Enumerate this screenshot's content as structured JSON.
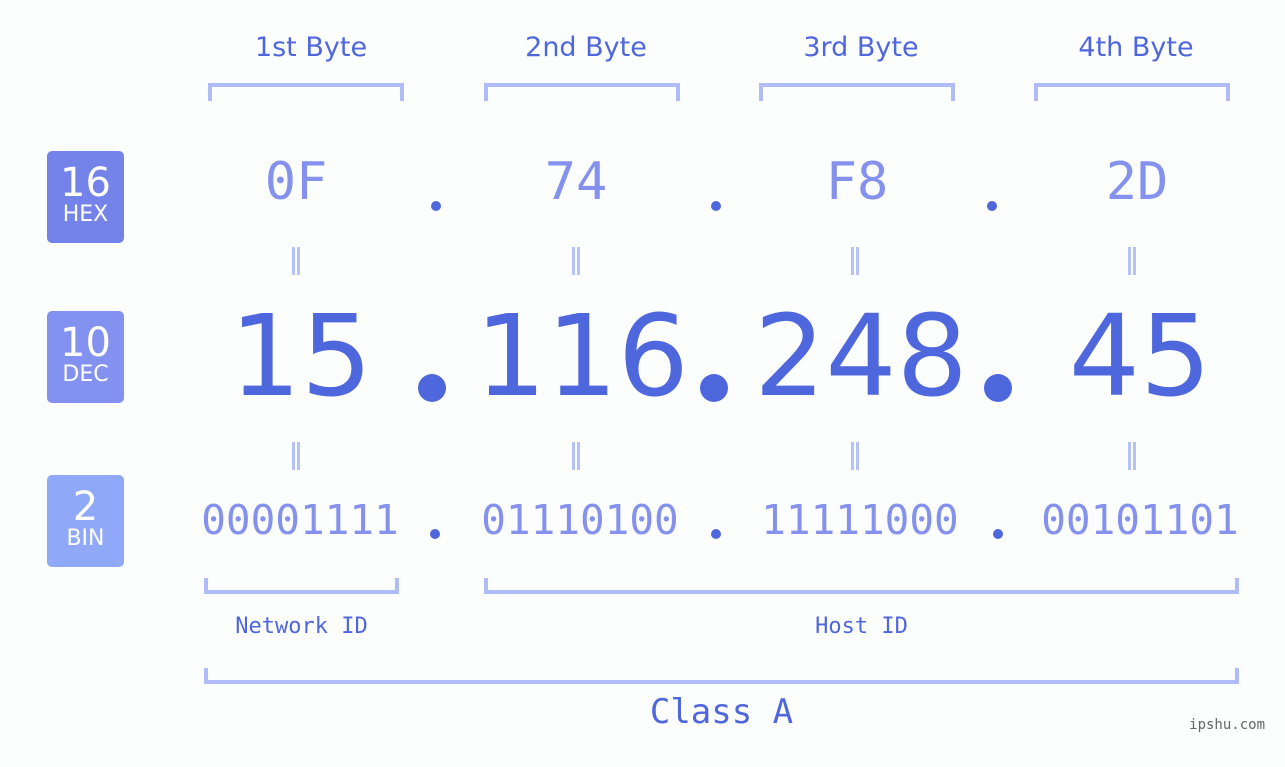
{
  "badges": [
    {
      "base": "16",
      "name": "HEX",
      "color": "#7383ea"
    },
    {
      "base": "10",
      "name": "DEC",
      "color": "#8392f0"
    },
    {
      "base": "2",
      "name": "BIN",
      "color": "#8fa8f8"
    }
  ],
  "byte_headers": [
    "1st Byte",
    "2nd Byte",
    "3rd Byte",
    "4th Byte"
  ],
  "hex": [
    "0F",
    "74",
    "F8",
    "2D"
  ],
  "dec": [
    "15",
    "116",
    "248",
    "45"
  ],
  "bin": [
    "00001111",
    "01110100",
    "11111000",
    "00101101"
  ],
  "network_label": "Network ID",
  "host_label": "Host ID",
  "class_label": "Class A",
  "watermark": "ipshu.com",
  "colors": {
    "accent": "#4f67dd",
    "light": "#8492ee",
    "bracket": "#b0bcf7"
  }
}
